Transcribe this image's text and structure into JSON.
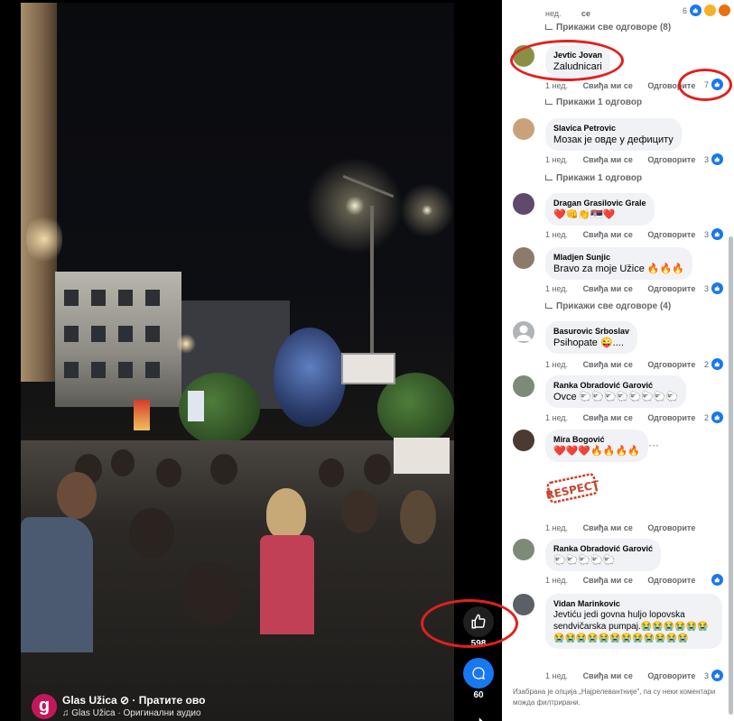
{
  "video": {
    "like_count": "598",
    "comment_count": "60",
    "channel_initial": "g",
    "channel_title": "Glas Užica ⊘ · Пратите ово",
    "channel_audio": "♫ Glas Užica · Оригинални аудио"
  },
  "comments": {
    "top_partial": {
      "meta_time": "нед.",
      "meta_like": "се",
      "likes": "6"
    },
    "items": [
      {
        "show_replies": "Прикажи све одговоре (8)"
      },
      {
        "name": "Jevtic Jovan",
        "text": "Zaludnicari",
        "time": "1 нед.",
        "like": "Свиђа ми се",
        "reply": "Одговорите",
        "likes": "7",
        "show_replies": "Прикажи 1 одговор"
      },
      {
        "name": "Slavica Petrovic",
        "text": "Мозак је овде у дефициту",
        "time": "1 нед.",
        "like": "Свиђа ми се",
        "reply": "Одговорите",
        "likes": "3",
        "show_replies": "Прикажи 1 одговор"
      },
      {
        "name": "Dragan Grasilovic Grale",
        "text": "❤️👊👏🇷🇸❤️",
        "time": "1 нед.",
        "like": "Свиђа ми се",
        "reply": "Одговорите",
        "likes": "3"
      },
      {
        "name": "Mladjen Sunjic",
        "text": "Bravo za moje Užice 🔥🔥🔥",
        "time": "1 нед.",
        "like": "Свиђа ми се",
        "reply": "Одговорите",
        "likes": "3",
        "show_replies": "Прикажи све одговоре (4)"
      },
      {
        "name": "Basurovic Srboslav",
        "text": "Psihopate 😜....",
        "time": "1 нед.",
        "like": "Свиђа ми се",
        "reply": "Одговорите",
        "likes": "2"
      },
      {
        "name": "Ranka Obradović Garović",
        "text": "Ovce 🐑🐑🐑🐑🐑🐑🐑🐑",
        "time": "1 нед.",
        "like": "Свиђа ми се",
        "reply": "Одговорите",
        "likes": "2"
      },
      {
        "name": "Mira Bogović",
        "text": "❤️❤️❤️🔥🔥🔥🔥",
        "sticker": "RESPECT",
        "time": "1 нед.",
        "like": "Свиђа ми се",
        "reply": "Одговорите",
        "likes": ""
      },
      {
        "name": "Ranka Obradović Garović",
        "text": "🐑🐑🐑🐑🐑",
        "time": "1 нед.",
        "like": "Свиђа ми се",
        "reply": "Одговорите",
        "likes": ""
      },
      {
        "name": "Vidan Marinkovic",
        "text": "Jevtiću jedi govna huljo lopovska sendvičarska pumpaj.😭😭😭😭😭😭😭😭😭😭😭😭😭😭😭😭😭😭",
        "time": "1 нед.",
        "like": "Свиђа ми се",
        "reply": "Одговорите",
        "likes": "3"
      }
    ],
    "footer_note": "Изабрана је опција „Најрелевантније\", па су неки коментари можда филтрирани."
  },
  "colors": {
    "annotation_red": "#e2201c",
    "like_blue": "#1877f2",
    "bubble_bg": "#f0f2f5",
    "meta_gray": "#65676b"
  }
}
